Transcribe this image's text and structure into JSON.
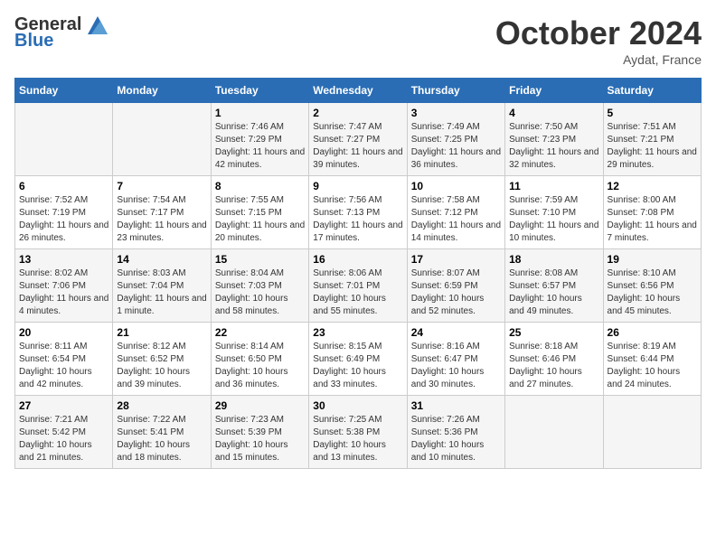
{
  "header": {
    "logo_line1": "General",
    "logo_line2": "Blue",
    "month": "October 2024",
    "location": "Aydat, France"
  },
  "days_of_week": [
    "Sunday",
    "Monday",
    "Tuesday",
    "Wednesday",
    "Thursday",
    "Friday",
    "Saturday"
  ],
  "weeks": [
    [
      {
        "day": "",
        "sunrise": "",
        "sunset": "",
        "daylight": ""
      },
      {
        "day": "",
        "sunrise": "",
        "sunset": "",
        "daylight": ""
      },
      {
        "day": "1",
        "sunrise": "Sunrise: 7:46 AM",
        "sunset": "Sunset: 7:29 PM",
        "daylight": "Daylight: 11 hours and 42 minutes."
      },
      {
        "day": "2",
        "sunrise": "Sunrise: 7:47 AM",
        "sunset": "Sunset: 7:27 PM",
        "daylight": "Daylight: 11 hours and 39 minutes."
      },
      {
        "day": "3",
        "sunrise": "Sunrise: 7:49 AM",
        "sunset": "Sunset: 7:25 PM",
        "daylight": "Daylight: 11 hours and 36 minutes."
      },
      {
        "day": "4",
        "sunrise": "Sunrise: 7:50 AM",
        "sunset": "Sunset: 7:23 PM",
        "daylight": "Daylight: 11 hours and 32 minutes."
      },
      {
        "day": "5",
        "sunrise": "Sunrise: 7:51 AM",
        "sunset": "Sunset: 7:21 PM",
        "daylight": "Daylight: 11 hours and 29 minutes."
      }
    ],
    [
      {
        "day": "6",
        "sunrise": "Sunrise: 7:52 AM",
        "sunset": "Sunset: 7:19 PM",
        "daylight": "Daylight: 11 hours and 26 minutes."
      },
      {
        "day": "7",
        "sunrise": "Sunrise: 7:54 AM",
        "sunset": "Sunset: 7:17 PM",
        "daylight": "Daylight: 11 hours and 23 minutes."
      },
      {
        "day": "8",
        "sunrise": "Sunrise: 7:55 AM",
        "sunset": "Sunset: 7:15 PM",
        "daylight": "Daylight: 11 hours and 20 minutes."
      },
      {
        "day": "9",
        "sunrise": "Sunrise: 7:56 AM",
        "sunset": "Sunset: 7:13 PM",
        "daylight": "Daylight: 11 hours and 17 minutes."
      },
      {
        "day": "10",
        "sunrise": "Sunrise: 7:58 AM",
        "sunset": "Sunset: 7:12 PM",
        "daylight": "Daylight: 11 hours and 14 minutes."
      },
      {
        "day": "11",
        "sunrise": "Sunrise: 7:59 AM",
        "sunset": "Sunset: 7:10 PM",
        "daylight": "Daylight: 11 hours and 10 minutes."
      },
      {
        "day": "12",
        "sunrise": "Sunrise: 8:00 AM",
        "sunset": "Sunset: 7:08 PM",
        "daylight": "Daylight: 11 hours and 7 minutes."
      }
    ],
    [
      {
        "day": "13",
        "sunrise": "Sunrise: 8:02 AM",
        "sunset": "Sunset: 7:06 PM",
        "daylight": "Daylight: 11 hours and 4 minutes."
      },
      {
        "day": "14",
        "sunrise": "Sunrise: 8:03 AM",
        "sunset": "Sunset: 7:04 PM",
        "daylight": "Daylight: 11 hours and 1 minute."
      },
      {
        "day": "15",
        "sunrise": "Sunrise: 8:04 AM",
        "sunset": "Sunset: 7:03 PM",
        "daylight": "Daylight: 10 hours and 58 minutes."
      },
      {
        "day": "16",
        "sunrise": "Sunrise: 8:06 AM",
        "sunset": "Sunset: 7:01 PM",
        "daylight": "Daylight: 10 hours and 55 minutes."
      },
      {
        "day": "17",
        "sunrise": "Sunrise: 8:07 AM",
        "sunset": "Sunset: 6:59 PM",
        "daylight": "Daylight: 10 hours and 52 minutes."
      },
      {
        "day": "18",
        "sunrise": "Sunrise: 8:08 AM",
        "sunset": "Sunset: 6:57 PM",
        "daylight": "Daylight: 10 hours and 49 minutes."
      },
      {
        "day": "19",
        "sunrise": "Sunrise: 8:10 AM",
        "sunset": "Sunset: 6:56 PM",
        "daylight": "Daylight: 10 hours and 45 minutes."
      }
    ],
    [
      {
        "day": "20",
        "sunrise": "Sunrise: 8:11 AM",
        "sunset": "Sunset: 6:54 PM",
        "daylight": "Daylight: 10 hours and 42 minutes."
      },
      {
        "day": "21",
        "sunrise": "Sunrise: 8:12 AM",
        "sunset": "Sunset: 6:52 PM",
        "daylight": "Daylight: 10 hours and 39 minutes."
      },
      {
        "day": "22",
        "sunrise": "Sunrise: 8:14 AM",
        "sunset": "Sunset: 6:50 PM",
        "daylight": "Daylight: 10 hours and 36 minutes."
      },
      {
        "day": "23",
        "sunrise": "Sunrise: 8:15 AM",
        "sunset": "Sunset: 6:49 PM",
        "daylight": "Daylight: 10 hours and 33 minutes."
      },
      {
        "day": "24",
        "sunrise": "Sunrise: 8:16 AM",
        "sunset": "Sunset: 6:47 PM",
        "daylight": "Daylight: 10 hours and 30 minutes."
      },
      {
        "day": "25",
        "sunrise": "Sunrise: 8:18 AM",
        "sunset": "Sunset: 6:46 PM",
        "daylight": "Daylight: 10 hours and 27 minutes."
      },
      {
        "day": "26",
        "sunrise": "Sunrise: 8:19 AM",
        "sunset": "Sunset: 6:44 PM",
        "daylight": "Daylight: 10 hours and 24 minutes."
      }
    ],
    [
      {
        "day": "27",
        "sunrise": "Sunrise: 7:21 AM",
        "sunset": "Sunset: 5:42 PM",
        "daylight": "Daylight: 10 hours and 21 minutes."
      },
      {
        "day": "28",
        "sunrise": "Sunrise: 7:22 AM",
        "sunset": "Sunset: 5:41 PM",
        "daylight": "Daylight: 10 hours and 18 minutes."
      },
      {
        "day": "29",
        "sunrise": "Sunrise: 7:23 AM",
        "sunset": "Sunset: 5:39 PM",
        "daylight": "Daylight: 10 hours and 15 minutes."
      },
      {
        "day": "30",
        "sunrise": "Sunrise: 7:25 AM",
        "sunset": "Sunset: 5:38 PM",
        "daylight": "Daylight: 10 hours and 13 minutes."
      },
      {
        "day": "31",
        "sunrise": "Sunrise: 7:26 AM",
        "sunset": "Sunset: 5:36 PM",
        "daylight": "Daylight: 10 hours and 10 minutes."
      },
      {
        "day": "",
        "sunrise": "",
        "sunset": "",
        "daylight": ""
      },
      {
        "day": "",
        "sunrise": "",
        "sunset": "",
        "daylight": ""
      }
    ]
  ]
}
